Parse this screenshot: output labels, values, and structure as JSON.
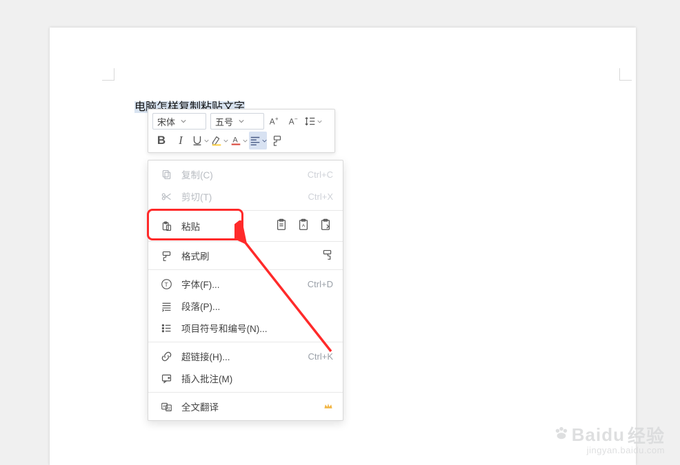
{
  "document": {
    "text": "电脑怎样复制粘贴文字"
  },
  "toolbar": {
    "font_family": "宋体",
    "font_size": "五号"
  },
  "menu": {
    "copy": {
      "label": "复制(C)",
      "shortcut": "Ctrl+C"
    },
    "cut": {
      "label": "剪切(T)",
      "shortcut": "Ctrl+X"
    },
    "paste": {
      "label": "粘贴"
    },
    "fmtbrush": {
      "label": "格式刷"
    },
    "font": {
      "label": "字体(F)...",
      "shortcut": "Ctrl+D"
    },
    "paragraph": {
      "label": "段落(P)..."
    },
    "bullets": {
      "label": "项目符号和编号(N)..."
    },
    "hyperlink": {
      "label": "超链接(H)...",
      "shortcut": "Ctrl+K"
    },
    "comment": {
      "label": "插入批注(M)"
    },
    "translate": {
      "label": "全文翻译"
    }
  },
  "watermark": {
    "main": "Baidu",
    "brand": "经验",
    "sub": "jingyan.baidu.com"
  }
}
